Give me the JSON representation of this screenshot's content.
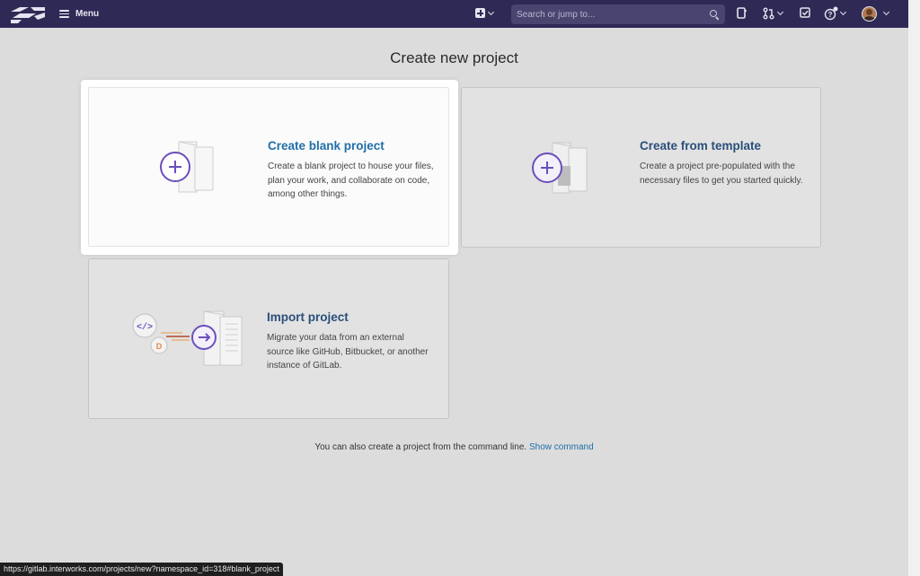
{
  "topbar": {
    "menu_label": "Menu",
    "search_placeholder": "Search or jump to...",
    "bg_color": "#2f2a55"
  },
  "page": {
    "title": "Create new project"
  },
  "cards": {
    "blank": {
      "title": "Create blank project",
      "description": "Create a blank project to house your files, plan your work, and collaborate on code, among other things.",
      "icon": "plus-document-icon"
    },
    "template": {
      "title": "Create from template",
      "description": "Create a project pre-populated with the necessary files to get you started quickly.",
      "icon": "template-document-icon"
    },
    "import": {
      "title": "Import project",
      "description": "Migrate your data from an external source like GitHub, Bitbucket, or another instance of GitLab.",
      "icon": "import-arrow-icon"
    }
  },
  "footer": {
    "text": "You can also create a project from the command line.",
    "link": "Show command"
  },
  "status_bar": {
    "url": "https://gitlab.interworks.com/projects/new?namespace_id=318#blank_project"
  },
  "colors": {
    "accent_purple": "#6b4fbb",
    "link_blue": "#1f6fa8"
  }
}
